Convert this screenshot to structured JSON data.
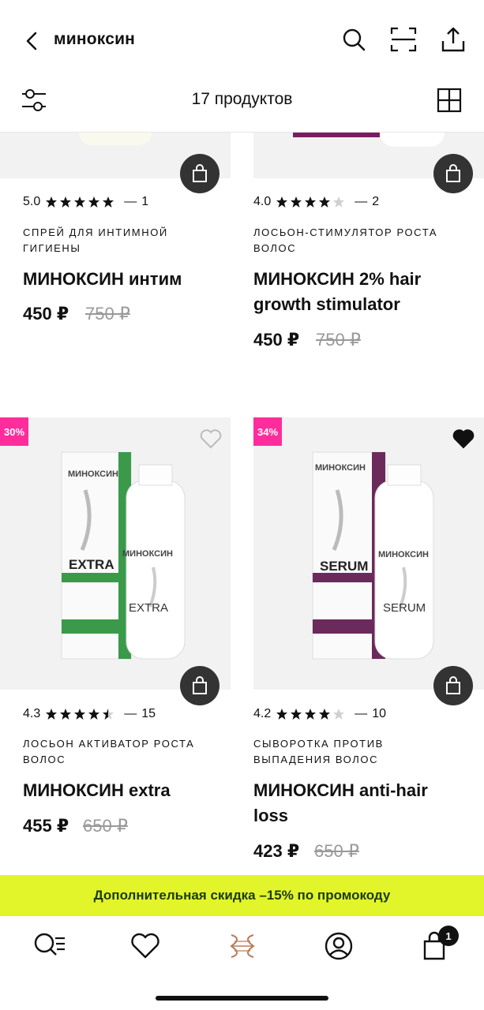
{
  "header": {
    "search_query": "миноксин",
    "product_count": "17 продуктов",
    "icons": [
      "back-arrow-icon",
      "search-icon",
      "scan-icon",
      "share-icon",
      "filter-icon",
      "grid-view-icon"
    ]
  },
  "products": [
    {
      "rating": "5.0",
      "stars": 5,
      "reviews": "1",
      "category": "СПРЕЙ ДЛЯ ИНТИМНОЙ ГИГИЕНЫ",
      "name": "МИНОКСИН интим",
      "price": "450 ₽",
      "old_price": "750 ₽"
    },
    {
      "rating": "4.0",
      "stars": 4,
      "reviews": "2",
      "category": "ЛОСЬОН-СТИМУЛЯТОР РОСТА ВОЛОС",
      "name": "МИНОКСИН 2% hair growth stimulator",
      "price": "450 ₽",
      "old_price": "750 ₽"
    },
    {
      "discount": "30%",
      "favorite": false,
      "rating": "4.3",
      "stars": 4.5,
      "reviews": "15",
      "category": "ЛОСЬОН АКТИВАТОР РОСТА ВОЛОС",
      "name": "МИНОКСИН extra",
      "price": "455 ₽",
      "old_price": "650 ₽",
      "box_brand": "МИНОКСИН",
      "box_title": "EXTRA",
      "box_color": "#3a9a4a",
      "bottle_brand": "МИНОКСИН",
      "bottle_title": "EXTRA"
    },
    {
      "discount": "34%",
      "favorite": true,
      "rating": "4.2",
      "stars": 4,
      "reviews": "10",
      "category": "СЫВОРОТКА ПРОТИВ ВЫПАДЕНИЯ ВОЛОС",
      "name": "МИНОКСИН anti-hair loss",
      "price": "423 ₽",
      "old_price": "650 ₽",
      "box_brand": "МИНОКСИН",
      "box_title": "SERUM",
      "box_color": "#6b2a5c",
      "bottle_brand": "МИНОКСИН",
      "bottle_title": "SERUM"
    }
  ],
  "promo": "Дополнительная скидка –15% по промокоду",
  "tabbar": {
    "icons": [
      "catalog-search-icon",
      "favorites-icon",
      "brand-logo-icon",
      "profile-icon",
      "cart-icon"
    ],
    "cart_count": "1"
  },
  "colors": {
    "accent": "#e2f52a",
    "badge": "#ff2d9b"
  }
}
